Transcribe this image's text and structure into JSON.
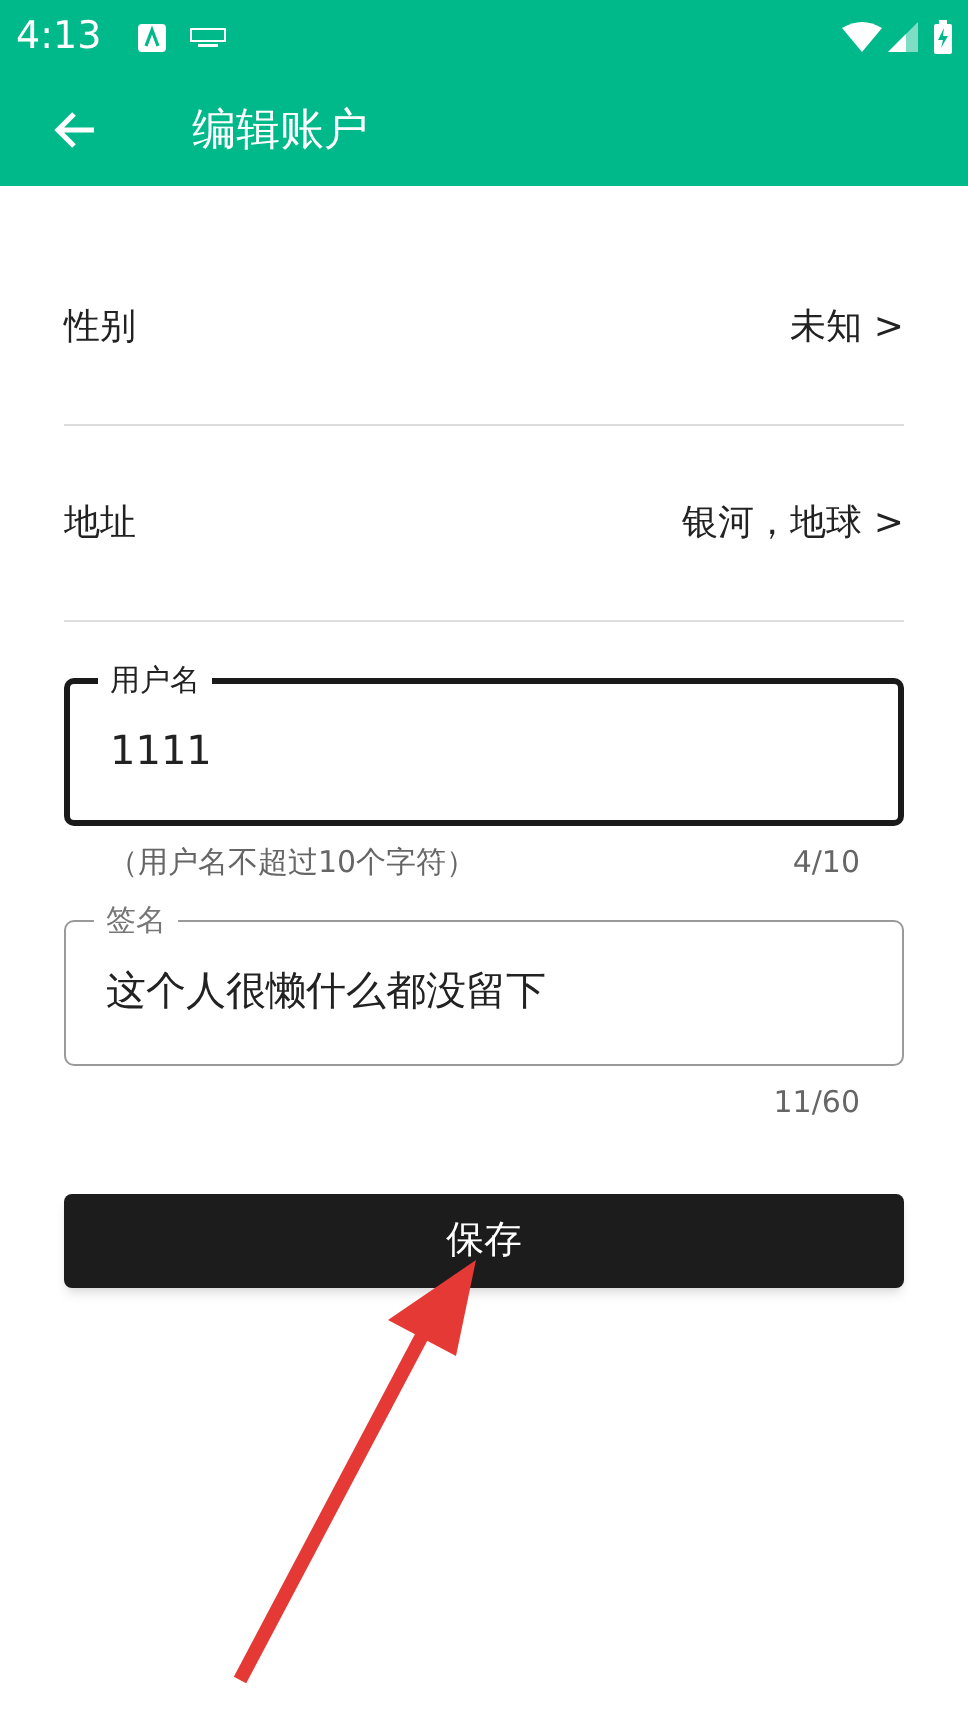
{
  "status_bar": {
    "time": "4:13"
  },
  "toolbar": {
    "title": "编辑账户"
  },
  "rows": [
    {
      "label": "性别",
      "value": "未知 >"
    },
    {
      "label": "地址",
      "value": "银河，地球 >"
    }
  ],
  "fields": [
    {
      "label": "用户名",
      "value": "1111",
      "focused": true,
      "helper": "（用户名不超过10个字符）",
      "counter": "4/10"
    },
    {
      "label": "签名",
      "value": "这个人很懒什么都没留下",
      "focused": false,
      "counter": "11/60"
    }
  ],
  "save_button": {
    "label": "保存"
  }
}
